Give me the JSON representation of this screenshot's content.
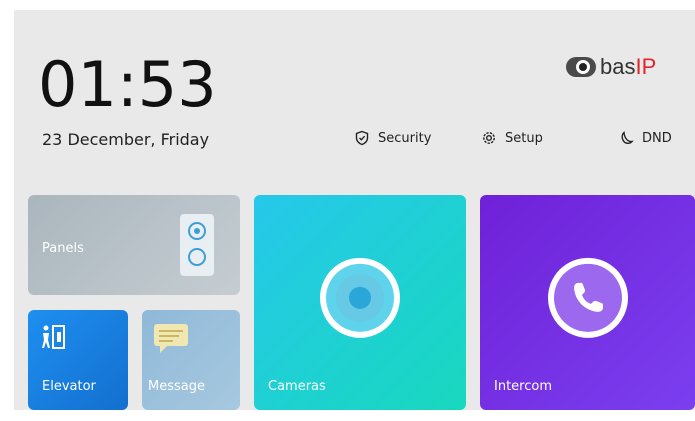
{
  "clock": {
    "time": "01:53",
    "date": "23 December, Friday"
  },
  "brand": {
    "name_prefix": "bas",
    "name_suffix": "IP"
  },
  "topnav": [
    {
      "label": "Security",
      "icon": "shield-icon"
    },
    {
      "label": "Setup",
      "icon": "gear-icon"
    },
    {
      "label": "DND",
      "icon": "moon-icon"
    }
  ],
  "tiles": {
    "panels": {
      "label": "Panels",
      "icon": "panel-device-icon",
      "color": "#b7c2c8"
    },
    "elevator": {
      "label": "Elevator",
      "icon": "elevator-icon",
      "color": "#1a82e6"
    },
    "message": {
      "label": "Message",
      "icon": "message-icon",
      "color": "#9fc2dc"
    },
    "cameras": {
      "label": "Cameras",
      "icon": "camera-icon",
      "color": "#20cfd8"
    },
    "intercom": {
      "label": "Intercom",
      "icon": "phone-icon",
      "color": "#7530e6"
    }
  }
}
